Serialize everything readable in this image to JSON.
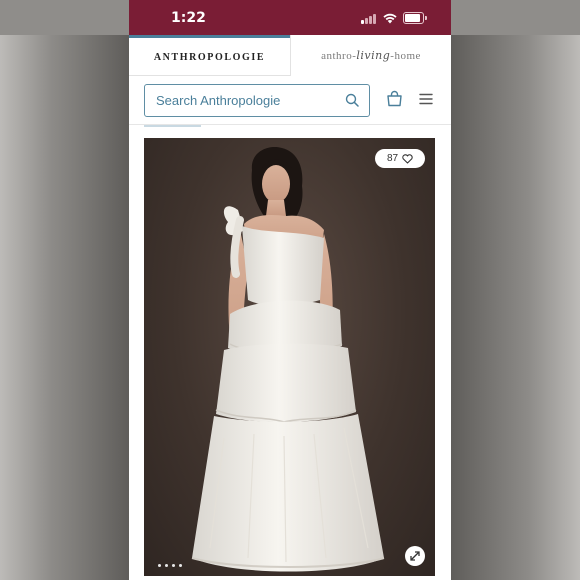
{
  "status_bar": {
    "time": "1:22"
  },
  "tabs": [
    {
      "label": "ANTHROPOLOGIE"
    },
    {
      "label_prefix": "anthro-",
      "label_script": "living",
      "label_suffix": "-home"
    }
  ],
  "search": {
    "placeholder": "Search Anthropologie"
  },
  "product": {
    "likes": "87",
    "image_description": "white tiered one-shoulder gown",
    "carousel_dots": 4
  },
  "colors": {
    "status_bar_bg": "#7a1d35",
    "accent": "#4a7f9a",
    "photo_background": "#3f332d"
  },
  "icons": [
    "wifi-icon",
    "battery-icon",
    "search-icon",
    "shopping-bag-icon",
    "hamburger-menu-icon",
    "heart-icon",
    "expand-icon"
  ]
}
